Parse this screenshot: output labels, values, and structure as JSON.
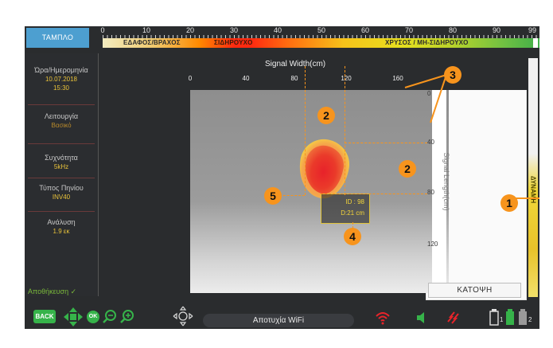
{
  "top_scale": {
    "ticks": [
      "0",
      "10",
      "20",
      "30",
      "40",
      "50",
      "60",
      "70",
      "80",
      "90",
      "99"
    ],
    "zones": [
      "ΕΔΑΦΟΣ/ΒΡΑΧΟΣ",
      "ΣΙΔΗΡΟΥΧΟ",
      "ΧΡΥΣΟΣ / ΜΗ-ΣΙΔΗΡΟΥΧΟ"
    ]
  },
  "sidebar": {
    "home_tab": "ΤΑΜΠΛΟ",
    "datetime_title": "Ώρα/Ημερομηνία",
    "date": "10.07.2018",
    "time": "15:30",
    "mode_title": "Λειτουργία",
    "mode_value": "Βασικό",
    "freq_title": "Συχνότητα",
    "freq_value": "5kHz",
    "coil_title": "Τύπος Πηνίου",
    "coil_value": "INV40",
    "res_title": "Ανάλυση",
    "res_value": "1.9 εκ",
    "save": "Αποθήκευση ✓"
  },
  "map": {
    "x_title": "Signal Width(cm)",
    "x_ticks": [
      "0",
      "40",
      "80",
      "120",
      "160"
    ],
    "y_ticks": [
      "0",
      "40",
      "80",
      "120"
    ],
    "y_title": "Signal Length(cm)",
    "plan_button": "ΚΑΤΟΨΗ",
    "target_id": "ID : 98",
    "target_depth": "D:21 cm"
  },
  "strength_bar": {
    "label": "ΔΥΝΑΜΗ"
  },
  "callouts": [
    "1",
    "2",
    "2",
    "3",
    "4",
    "5"
  ],
  "toolbar": {
    "back": "BACK",
    "ok": "OK",
    "wifi_status": "Αποτυχία WiFi",
    "battery1": "1",
    "battery2": "2"
  },
  "colors": {
    "accent_orange": "#f7941d",
    "home_tab": "#4d9fd0",
    "green": "#36b34a",
    "value_yellow": "#e8c23a"
  }
}
